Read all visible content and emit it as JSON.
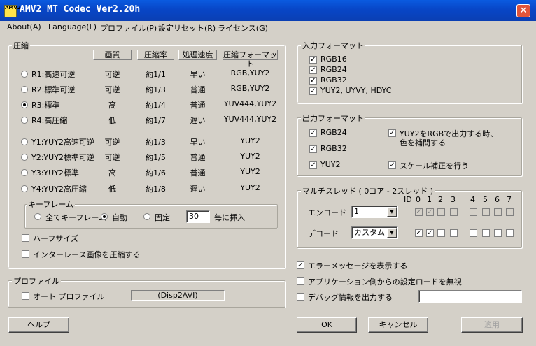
{
  "window": {
    "title": "AMV2 MT Codec Ver2.20h",
    "icon_text": "AMV2",
    "close": "✕"
  },
  "menu": [
    "About(A)",
    "Language(L)",
    "プロファイル(P)",
    "設定リセット(R)",
    "ライセンス(G)"
  ],
  "compression": {
    "title": "圧縮",
    "headers": [
      "画質",
      "圧縮率",
      "処理速度",
      "圧縮フォーマット"
    ],
    "rows": [
      {
        "label": "R1:高速可逆",
        "quality": "可逆",
        "ratio": "約1/1",
        "speed": "早い",
        "format": "RGB,YUY2",
        "selected": false
      },
      {
        "label": "R2:標準可逆",
        "quality": "可逆",
        "ratio": "約1/3",
        "speed": "普通",
        "format": "RGB,YUY2",
        "selected": false
      },
      {
        "label": "R3:標準",
        "quality": "高",
        "ratio": "約1/4",
        "speed": "普通",
        "format": "YUV444,YUY2",
        "selected": true
      },
      {
        "label": "R4:高圧縮",
        "quality": "低",
        "ratio": "約1/7",
        "speed": "遅い",
        "format": "YUV444,YUY2",
        "selected": false
      },
      {
        "label": "Y1:YUY2高速可逆",
        "quality": "可逆",
        "ratio": "約1/3",
        "speed": "早い",
        "format": "YUY2",
        "selected": false
      },
      {
        "label": "Y2:YUY2標準可逆",
        "quality": "可逆",
        "ratio": "約1/5",
        "speed": "普通",
        "format": "YUY2",
        "selected": false
      },
      {
        "label": "Y3:YUY2標準",
        "quality": "高",
        "ratio": "約1/6",
        "speed": "普通",
        "format": "YUY2",
        "selected": false
      },
      {
        "label": "Y4:YUY2高圧縮",
        "quality": "低",
        "ratio": "約1/8",
        "speed": "遅い",
        "format": "YUY2",
        "selected": false
      }
    ],
    "keyframe": {
      "title": "キーフレーム",
      "all": "全てキーフレーム",
      "auto": "自動",
      "fixed": "固定",
      "interval": "30",
      "suffix": "毎に挿入",
      "selected": "auto"
    },
    "half_size": "ハーフサイズ",
    "interlace": "インターレース画像を圧縮する"
  },
  "profile": {
    "title": "プロファイル",
    "auto": "オート プロファイル",
    "value": "(Disp2AVI)"
  },
  "input_format": {
    "title": "入力フォーマット",
    "items": [
      "RGB16",
      "RGB24",
      "RGB32",
      "YUY2, UYVY, HDYC"
    ]
  },
  "output_format": {
    "title": "出力フォーマット",
    "rgb24": "RGB24",
    "rgb32": "RGB32",
    "yuy2": "YUY2",
    "yuy2_to_rgb": "YUY2をRGBで出力する時、",
    "yuy2_to_rgb_2": "色を補間する",
    "scale": "スケール補正を行う"
  },
  "multithread": {
    "title": "マルチスレッド ( 0コア - 2スレッド )",
    "id_label": "ID",
    "ids": [
      "0",
      "1",
      "2",
      "3",
      "4",
      "5",
      "6",
      "7"
    ],
    "encode_label": "エンコード",
    "encode_value": "1",
    "decode_label": "デコード",
    "decode_value": "カスタム"
  },
  "options": {
    "error": "エラーメッセージを表示する",
    "ignore": "アプリケーション側からの設定ロードを無視",
    "debug": "デバッグ情報を出力する"
  },
  "buttons": {
    "help": "ヘルプ",
    "ok": "OK",
    "cancel": "キャンセル",
    "apply": "適用"
  },
  "check_glyph": "✓"
}
